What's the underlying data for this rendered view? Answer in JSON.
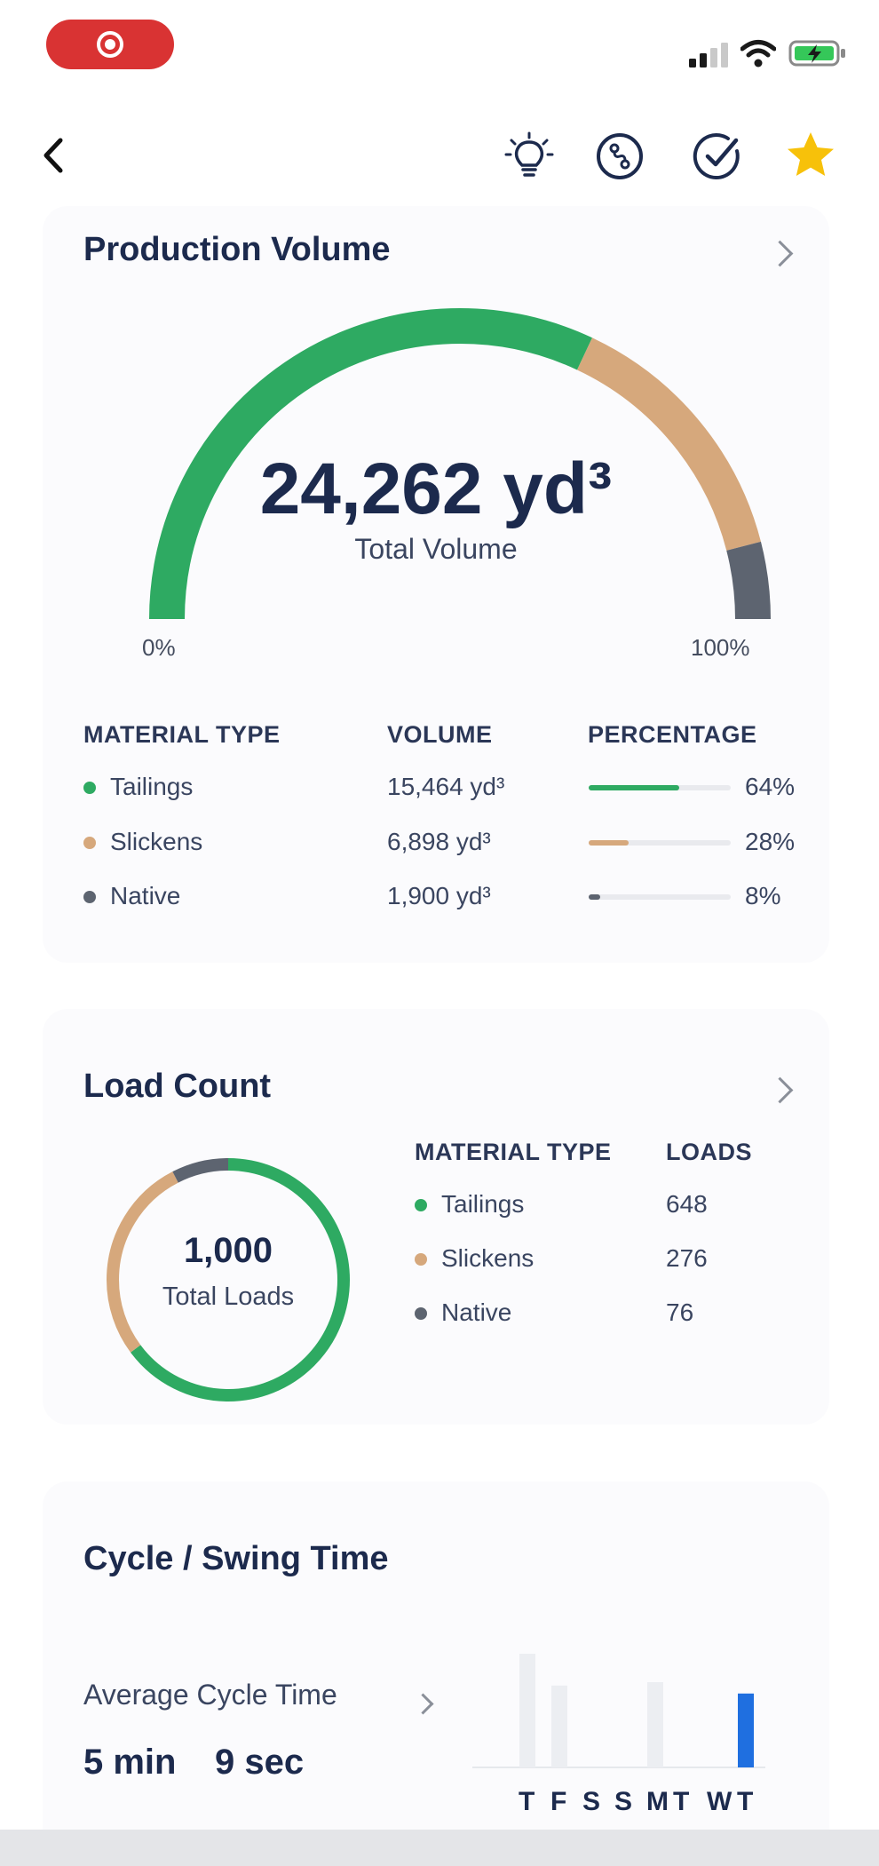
{
  "header": {
    "icons": [
      "back-icon",
      "lightbulb-icon",
      "route-icon",
      "check-circle-icon",
      "star-icon"
    ],
    "accent": "#1c2a4d",
    "star_color": "#f7c10a"
  },
  "production": {
    "title": "Production Volume",
    "total_value": "24,262 yd³",
    "total_label": "Total Volume",
    "min_label": "0%",
    "max_label": "100%",
    "headers": {
      "material": "MATERIAL TYPE",
      "volume": "VOLUME",
      "percentage": "PERCENTAGE"
    },
    "rows": [
      {
        "name": "Tailings",
        "volume": "15,464 yd³",
        "percent": "64%",
        "fraction": 0.64,
        "color": "#2eaa62"
      },
      {
        "name": "Slickens",
        "volume": "6,898 yd³",
        "percent": "28%",
        "fraction": 0.28,
        "color": "#d6a87c"
      },
      {
        "name": "Native",
        "volume": "1,900 yd³",
        "percent": "8%",
        "fraction": 0.08,
        "color": "#5d6470"
      }
    ]
  },
  "loads": {
    "title": "Load Count",
    "total_value": "1,000",
    "total_label": "Total Loads",
    "headers": {
      "material": "MATERIAL TYPE",
      "loads": "LOADS"
    },
    "rows": [
      {
        "name": "Tailings",
        "loads": "648",
        "count": 648,
        "color": "#2eaa62"
      },
      {
        "name": "Slickens",
        "loads": "276",
        "count": 276,
        "color": "#d6a87c"
      },
      {
        "name": "Native",
        "loads": "76",
        "count": 76,
        "color": "#5d6470"
      }
    ]
  },
  "cycle": {
    "title": "Cycle / Swing Time",
    "avg_label": "Average Cycle Time",
    "minutes": "5 min",
    "seconds": "9 sec"
  },
  "chart_data": {
    "type": "bar",
    "categories": [
      "T",
      "F",
      "S",
      "S",
      "M",
      "T",
      "W",
      "T"
    ],
    "values": [
      100,
      72,
      0,
      0,
      75,
      0,
      0,
      65
    ],
    "highlight_index": 7,
    "bar_color": "#eceef2",
    "highlight_color": "#1f6fe0",
    "grid": false
  }
}
